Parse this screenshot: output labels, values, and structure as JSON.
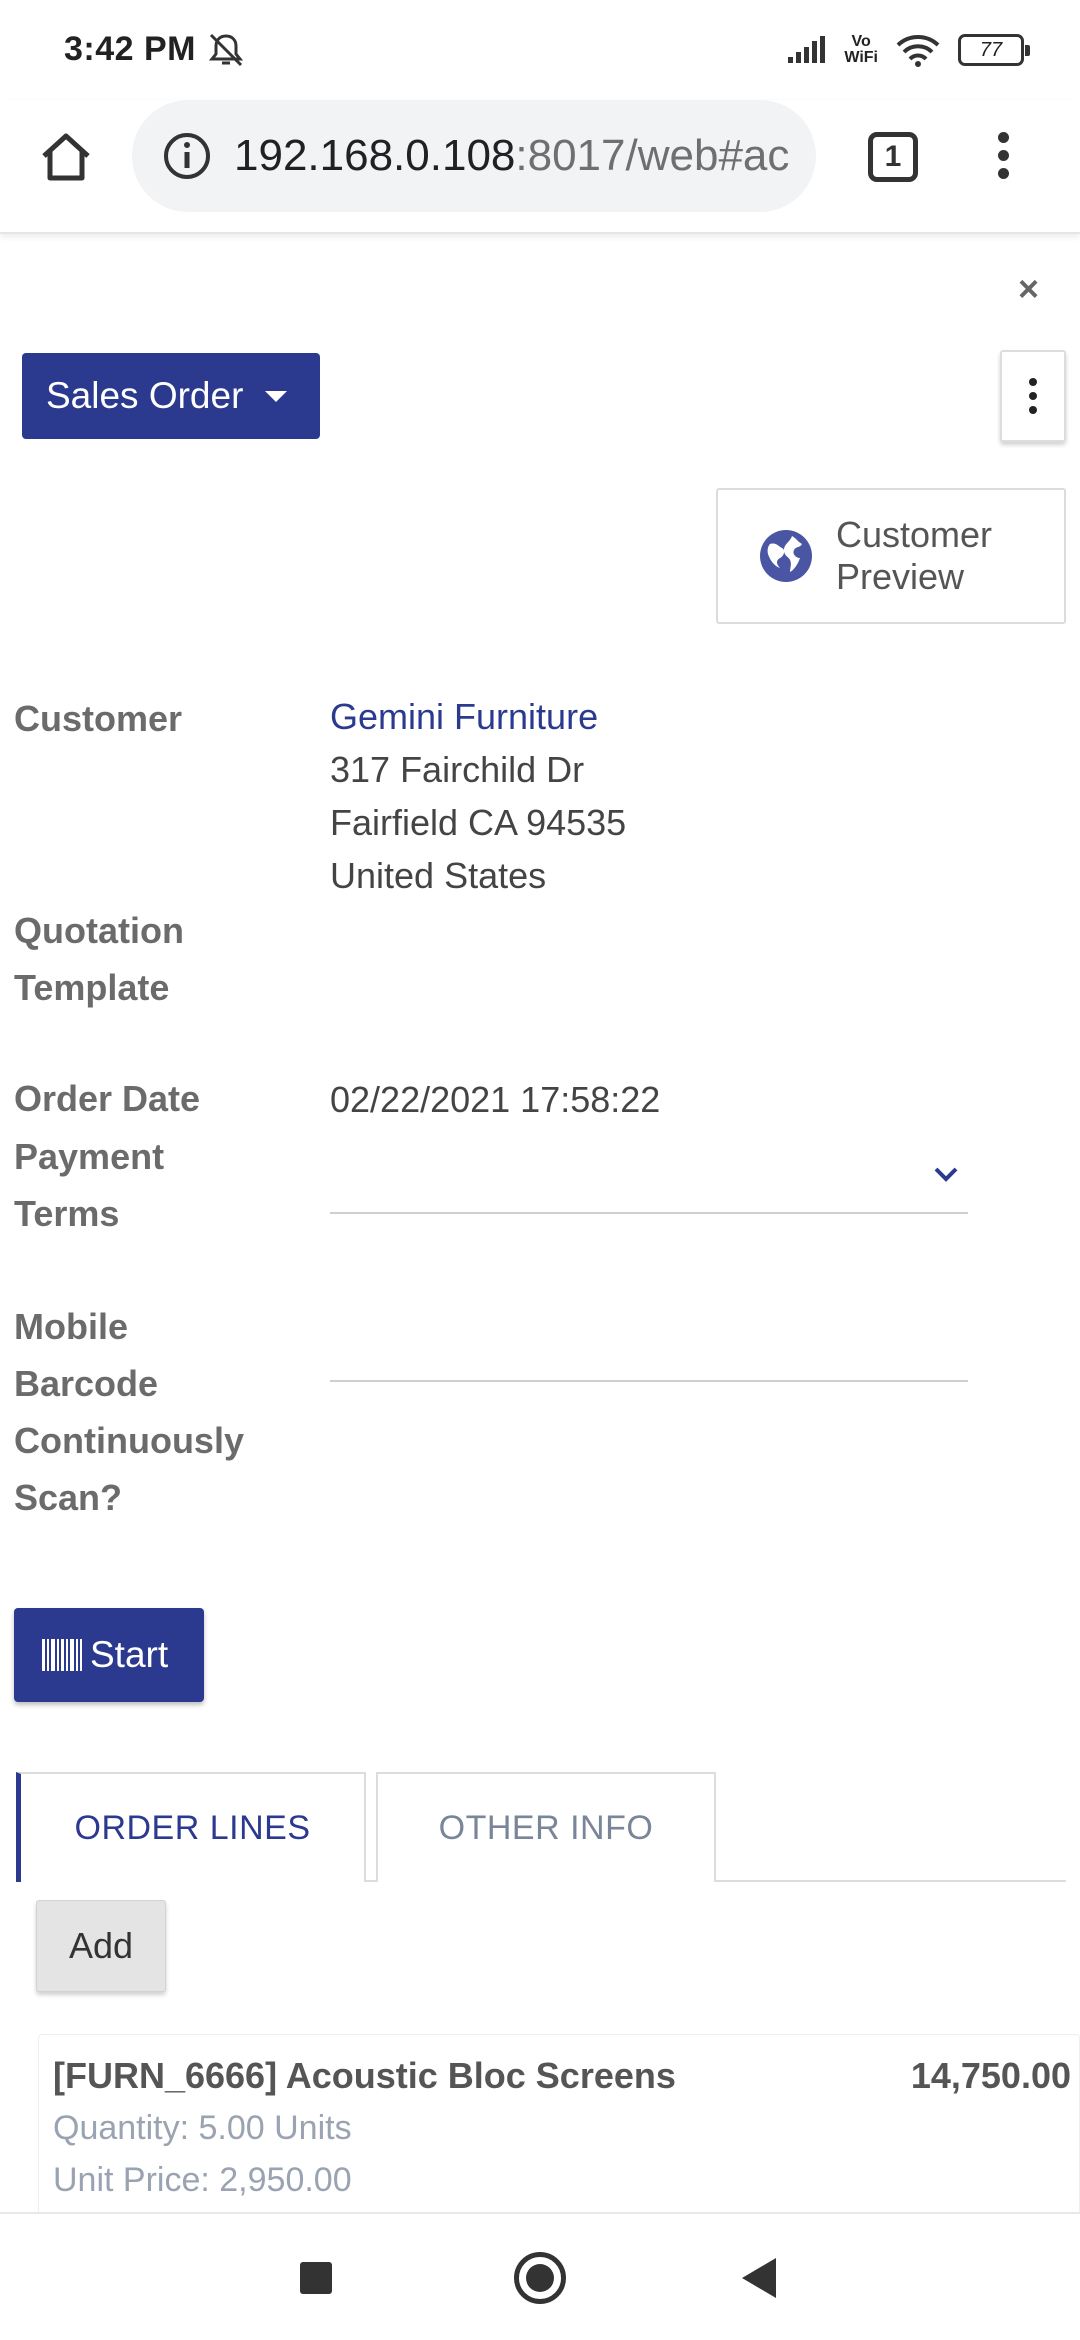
{
  "status_bar": {
    "time": "3:42 PM",
    "vowifi_top": "Vo",
    "vowifi_bottom": "WiFi",
    "battery": "77"
  },
  "browser": {
    "url_host": "192.168.0.108",
    "url_rest": ":8017/web#ac",
    "tab_count": "1"
  },
  "toolbar": {
    "view_switcher_label": "Sales Order",
    "close_symbol": "×"
  },
  "header": {
    "customer_preview_label": "Customer Preview"
  },
  "form": {
    "customer_label": "Customer",
    "customer_name": "Gemini Furniture",
    "address_line1": "317 Fairchild Dr",
    "address_line2": "Fairfield CA 94535",
    "address_line3": "United States",
    "quotation_template_label": "Quotation Template",
    "order_date_label": "Order Date",
    "order_date_value": "02/22/2021 17:58:22",
    "payment_terms_label": "Payment Terms",
    "payment_terms_value": "",
    "mobile_barcode_label": "Mobile Barcode Continuously Scan?",
    "start_button_label": "Start"
  },
  "tabs": [
    {
      "label": "ORDER LINES",
      "active": true
    },
    {
      "label": "OTHER INFO",
      "active": false
    }
  ],
  "order_lines": {
    "add_label": "Add",
    "items": [
      {
        "product": "[FURN_6666] Acoustic Bloc Screens",
        "subtotal": "14,750.00",
        "quantity": "Quantity: 5.00 Units",
        "unit_price": "Unit Price: 2,950.00"
      }
    ]
  },
  "colors": {
    "primary": "#2b3a8f",
    "label_gray": "#6b6b6b",
    "muted_blue_gray": "#9aa3b1"
  },
  "icons": [
    "home-icon",
    "info-icon",
    "tabs-icon",
    "more-vert-icon",
    "close-icon",
    "caret-down-icon",
    "kebab-icon",
    "globe-icon",
    "chevron-down-icon",
    "barcode-icon",
    "nav-recents-icon",
    "nav-home-icon",
    "nav-back-icon",
    "mute-icon",
    "signal-icon",
    "wifi-icon",
    "battery-icon"
  ]
}
